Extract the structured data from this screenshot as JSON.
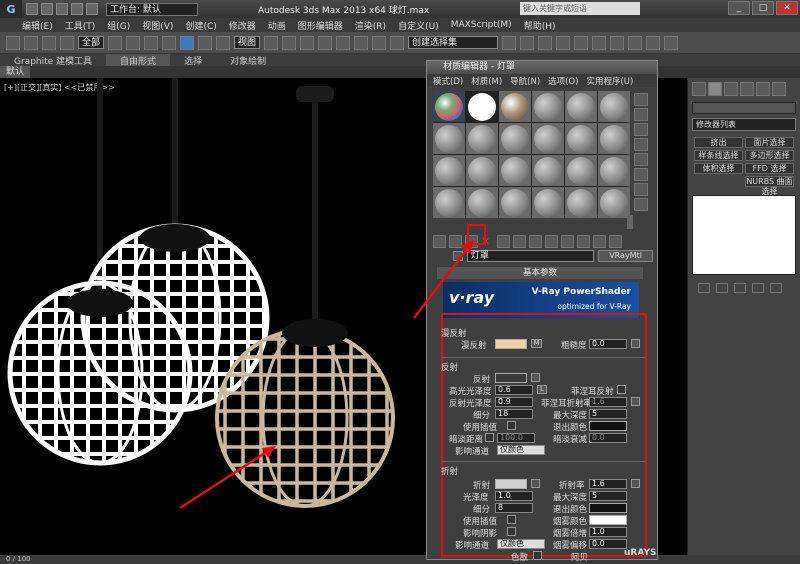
{
  "titlebar": {
    "workspace": "工作台: 默认",
    "title": "Autodesk 3ds Max  2013 x64    球灯.max",
    "search_placeholder": "键入关键字或短语"
  },
  "menubar": {
    "items": [
      "编辑(E)",
      "工具(T)",
      "组(G)",
      "视图(V)",
      "创建(C)",
      "修改器",
      "动画",
      "图形编辑器",
      "渲染(R)",
      "自定义(U)",
      "MAXScript(M)",
      "帮助(H)"
    ]
  },
  "toolbar": {
    "selection_filter": "全部",
    "ref_coord": "视图",
    "named_selection": "创建选择集"
  },
  "ribbon": {
    "tabs": [
      "Graphite 建模工具",
      "自由形式",
      "选择",
      "对象绘制"
    ]
  },
  "subtab": "默认",
  "viewport": {
    "label": "[+][正交][真实] <<已禁用>>"
  },
  "statusbar": "0 / 100",
  "command_panel": {
    "modifier_list": "修改器列表",
    "buttons": [
      "挤出",
      "面片选择",
      "样条线选择",
      "多边形选择",
      "体积选择",
      "FFD 选择",
      "NURBS 曲面选择"
    ]
  },
  "material_editor": {
    "title": "材质编辑器 - 灯罩",
    "menu": [
      "模式(D)",
      "材质(M)",
      "导航(N)",
      "选项(O)",
      "实用程序(U)"
    ],
    "material_name": "灯罩",
    "material_type": "VRayMtl",
    "rollout": "基本参数",
    "banner": {
      "logo": "v·ray",
      "line1": "V-Ray PowerShader",
      "line2": "optimized for V-Ray"
    },
    "diffuse": {
      "group": "漫反射",
      "diffuse_label": "漫反射",
      "diffuse_color": "#f0d2a8",
      "map_button": "M",
      "roughness_label": "粗糙度",
      "roughness": "0.0"
    },
    "reflection": {
      "group": "反射",
      "reflect_label": "反射",
      "hilight_gloss_label": "高光光泽度",
      "hilight_gloss": "0.6",
      "lock_button": "L",
      "fresnel_label": "菲涅耳反射",
      "refl_gloss_label": "反射光泽度",
      "refl_gloss": "0.9",
      "fresnel_ior_label": "菲涅耳折射率",
      "fresnel_ior": "1.6",
      "subdivs_label": "细分",
      "subdivs": "18",
      "max_depth_label": "最大深度",
      "max_depth": "5",
      "interp_label": "使用插值",
      "exit_color_label": "退出颜色",
      "dim_dist_label": "暗淡距离",
      "dim_dist": "100.0",
      "dim_falloff_label": "暗淡衰减",
      "dim_falloff": "0.0",
      "affect_channels_label": "影响通道",
      "affect_channels": "仅颜色"
    },
    "refraction": {
      "group": "折射",
      "refract_label": "折射",
      "ior_label": "折射率",
      "ior": "1.6",
      "gloss_label": "光泽度",
      "gloss": "1.0",
      "max_depth_label": "最大深度",
      "max_depth": "5",
      "subdivs_label": "细分",
      "subdivs": "8",
      "exit_color_label": "退出颜色",
      "interp_label": "使用插值",
      "fog_color_label": "烟雾颜色",
      "shadows_label": "影响阴影",
      "fog_mult_label": "烟雾倍增",
      "fog_mult": "1.0",
      "affect_channels_label": "影响通道",
      "affect_channels": "仅颜色",
      "fog_bias_label": "烟雾偏移",
      "fog_bias": "0.0",
      "dispersion_label": "色散",
      "abbe_label": "阿贝"
    }
  },
  "watermark": "uRAYS"
}
